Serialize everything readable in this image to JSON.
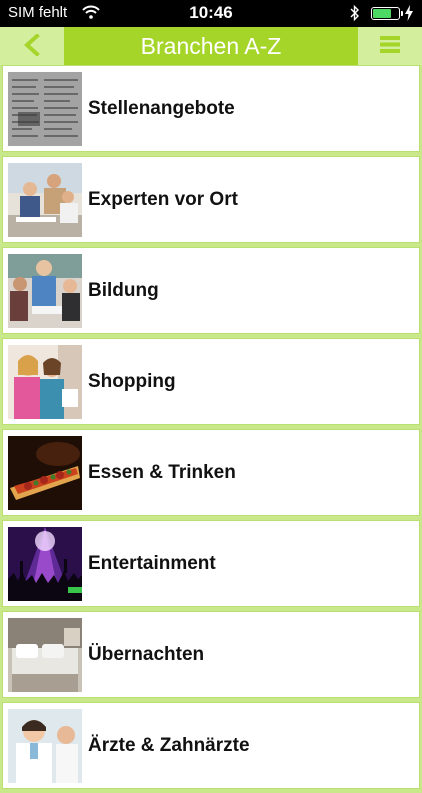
{
  "status_bar": {
    "carrier": "SIM fehlt",
    "time": "10:46",
    "battery_level": 0.75
  },
  "navbar": {
    "title": "Branchen A-Z",
    "back_icon": "chevron-left-icon",
    "menu_icon": "hamburger-menu-icon",
    "accent_color": "#a6d52a",
    "button_color": "#d3ee9d"
  },
  "categories": [
    {
      "label": "Stellenangebote",
      "thumbnail": "newspaper"
    },
    {
      "label": "Experten vor Ort",
      "thumbnail": "business-meeting"
    },
    {
      "label": "Bildung",
      "thumbnail": "teacher-students"
    },
    {
      "label": "Shopping",
      "thumbnail": "women-shopping"
    },
    {
      "label": "Essen & Trinken",
      "thumbnail": "pizza"
    },
    {
      "label": "Entertainment",
      "thumbnail": "concert-crowd"
    },
    {
      "label": "Übernachten",
      "thumbnail": "hotel-bed"
    },
    {
      "label": "Ärzte & Zahnärzte",
      "thumbnail": "doctor"
    }
  ]
}
